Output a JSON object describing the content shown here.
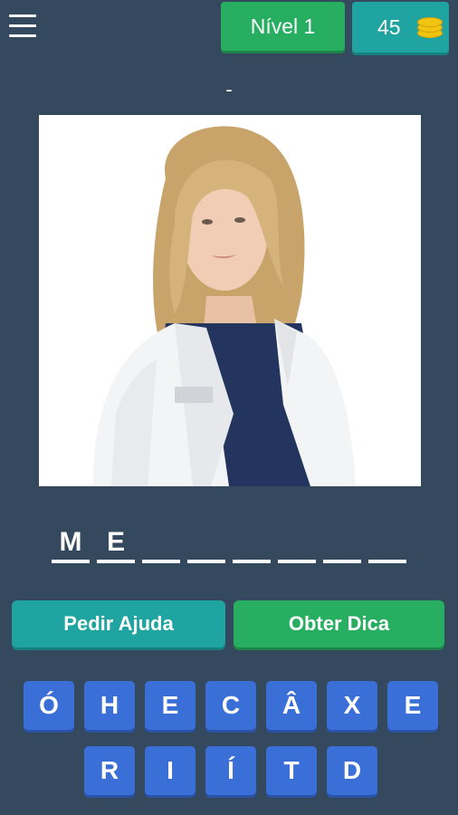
{
  "header": {
    "menu_icon": "hamburger-menu-icon",
    "level_label": "Nível 1",
    "coins": "45",
    "coins_icon": "coin-stack-icon"
  },
  "subtitle": "-",
  "answer_slots": [
    "M",
    "E",
    "",
    "",
    "",
    "",
    "",
    ""
  ],
  "actions": {
    "help_label": "Pedir Ajuda",
    "hint_label": "Obter Dica"
  },
  "keyboard": {
    "row1": [
      "Ó",
      "H",
      "E",
      "C",
      "Â",
      "X",
      "E"
    ],
    "row2": [
      "R",
      "I",
      "Í",
      "T",
      "D"
    ]
  },
  "colors": {
    "background": "#34495e",
    "green": "#27ae60",
    "teal": "#1fa4a1",
    "key_blue": "#3b6fd8"
  }
}
